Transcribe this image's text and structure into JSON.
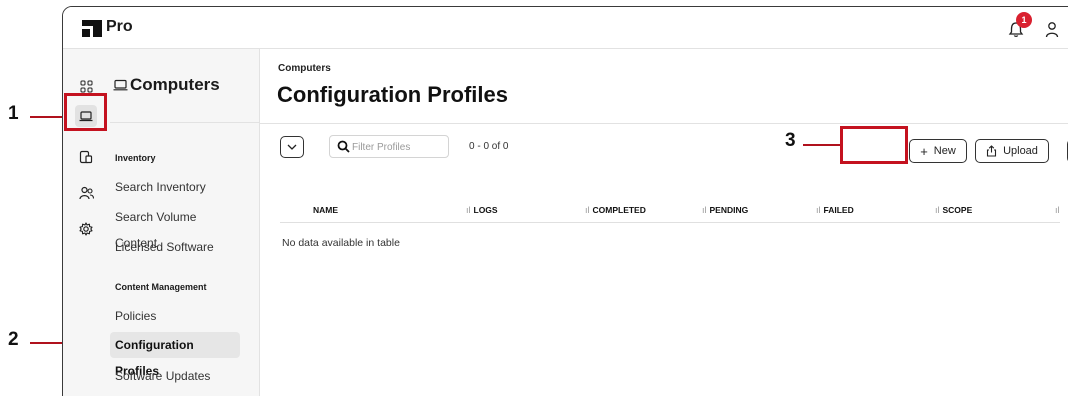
{
  "app": {
    "brand": "Pro",
    "notification_count": "1"
  },
  "rail": {
    "icons": [
      "dashboard-icon",
      "computers-icon",
      "devices-icon",
      "users-icon",
      "settings-icon"
    ]
  },
  "nav": {
    "title": "Computers",
    "sections": [
      {
        "label": "Inventory",
        "items": [
          "Search Inventory",
          "Search Volume Content",
          "Licensed Software"
        ]
      },
      {
        "label": "Content Management",
        "items": [
          "Policies",
          "Configuration Profiles",
          "Software Updates"
        ]
      }
    ]
  },
  "main": {
    "breadcrumb": "Computers",
    "title": "Configuration Profiles",
    "filter_placeholder": "Filter Profiles",
    "count": "0 - 0 of 0",
    "new_label": "New",
    "upload_label": "Upload",
    "columns": [
      "NAME",
      "LOGS",
      "COMPLETED",
      "PENDING",
      "FAILED",
      "SCOPE"
    ],
    "empty_text": "No data available in table"
  },
  "annotations": [
    "1",
    "2",
    "3"
  ],
  "colors": {
    "callout": "#c4121f",
    "badge": "#d9202f",
    "active_nav": "#e6e6e6"
  }
}
